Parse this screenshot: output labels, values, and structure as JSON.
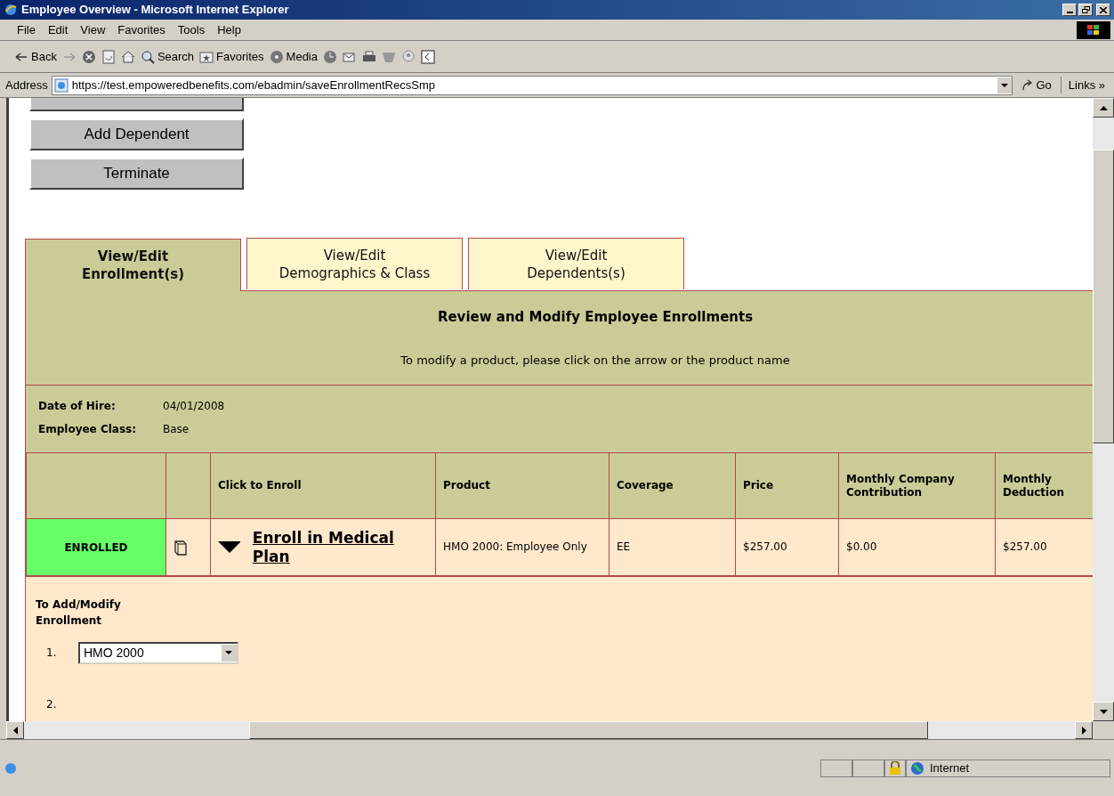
{
  "window": {
    "title": "Employee Overview - Microsoft Internet Explorer"
  },
  "menu": [
    "File",
    "Edit",
    "View",
    "Favorites",
    "Tools",
    "Help"
  ],
  "toolbar": [
    {
      "kind": "back",
      "label": "Back"
    },
    {
      "kind": "forward"
    },
    {
      "kind": "stop"
    },
    {
      "kind": "refresh"
    },
    {
      "kind": "home"
    },
    {
      "kind": "search",
      "label": "Search"
    },
    {
      "kind": "favorites",
      "label": "Favorites"
    },
    {
      "kind": "media",
      "label": "Media"
    },
    {
      "kind": "history"
    },
    {
      "kind": "mail"
    },
    {
      "kind": "print"
    },
    {
      "kind": "word"
    },
    {
      "kind": "messenger"
    },
    {
      "kind": "research"
    }
  ],
  "address": {
    "label": "Address",
    "value": "https://test.empoweredbenefits.com/ebadmin/saveEnrollmentRecsSmp",
    "go": "Go",
    "links": "Links »"
  },
  "actions": [
    "Add Dependent",
    "Terminate"
  ],
  "tabs": [
    {
      "label": "View/Edit\nEnrollment(s)",
      "selected": true
    },
    {
      "label": "View/Edit\nDemographics & Class",
      "selected": false
    },
    {
      "label": "View/Edit\nDependents(s)",
      "selected": false
    }
  ],
  "panel": {
    "title": "Review and Modify Employee Enrollments",
    "instruction": "To modify a product, please click on the arrow or the product name"
  },
  "info": [
    {
      "label": "Date of Hire:",
      "value": "04/01/2008"
    },
    {
      "label": "Employee Class:",
      "value": "Base"
    }
  ],
  "table": {
    "columns": [
      "Click to Enroll",
      "Product",
      "Coverage",
      "Price",
      "Monthly Company Contribution",
      "Monthly Deduction"
    ],
    "rows": [
      {
        "status": "ENROLLED",
        "enrolled": true,
        "link": "Enroll in Medical Plan",
        "product": "HMO 2000: Employee Only",
        "coverage": "EE",
        "price": "$257.00",
        "contribution": "$0.00",
        "deduction": "$257.00"
      }
    ]
  },
  "modify": {
    "title": "To Add/Modify Enrollment",
    "steps": [
      {
        "number": "1.",
        "select": "HMO 2000"
      },
      {
        "number": "2."
      }
    ]
  },
  "status_bar": {
    "zone": "Internet"
  }
}
